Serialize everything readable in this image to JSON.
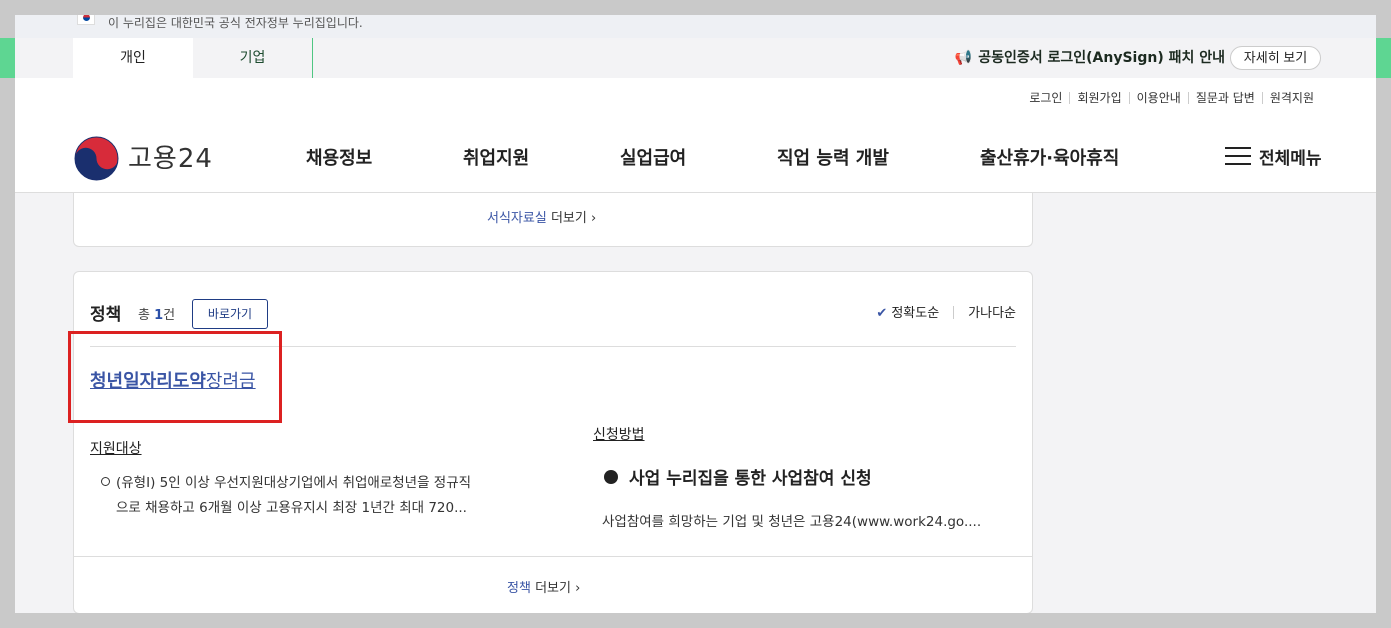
{
  "gov_banner": {
    "text": "이 누리집은 대한민국 공식 전자정부 누리집입니다."
  },
  "top_tabs": [
    {
      "label": "개인"
    },
    {
      "label": "기업"
    }
  ],
  "notice": {
    "text": "공동인증서 로그인(AnySign) 패치 안내",
    "button": "자세히 보기"
  },
  "util_links": [
    "로그인",
    "회원가입",
    "이용안내",
    "질문과 답변",
    "원격지원"
  ],
  "logo": {
    "text": "고용24"
  },
  "gnb": [
    "채용정보",
    "취업지원",
    "실업급여",
    "직업 능력 개발",
    "출산휴가·육아휴직"
  ],
  "all_menu": "전체메뉴",
  "forms_more": {
    "accent": "서식자료실",
    "suffix": "더보기"
  },
  "policy": {
    "title": "정책",
    "count_prefix": "총",
    "count": "1",
    "count_suffix": "건",
    "goto_button": "바로가기",
    "sort": {
      "active": "정확도순",
      "other": "가나다순"
    },
    "item": {
      "title_bold": "청년일자리도약",
      "title_rest": "장려금",
      "target_label": "지원대상",
      "target_line1": "(유형I) 5인 이상 우선지원대상기업에서 취업애로청년을 정규직",
      "target_line2": "으로 채용하고 6개월 이상 고용유지시 최장 1년간 최대 720...",
      "method_label": "신청방법",
      "method_head": "사업 누리집을 통한 사업참여 신청",
      "method_body": "사업참여를 희망하는 기업 및 청년은 고용24(www.work24.go...."
    },
    "more": {
      "accent": "정책",
      "suffix": "더보기"
    }
  },
  "colors": {
    "green": "#5ed692",
    "accent": "#3a55a5",
    "highlight": "#dc2121"
  }
}
